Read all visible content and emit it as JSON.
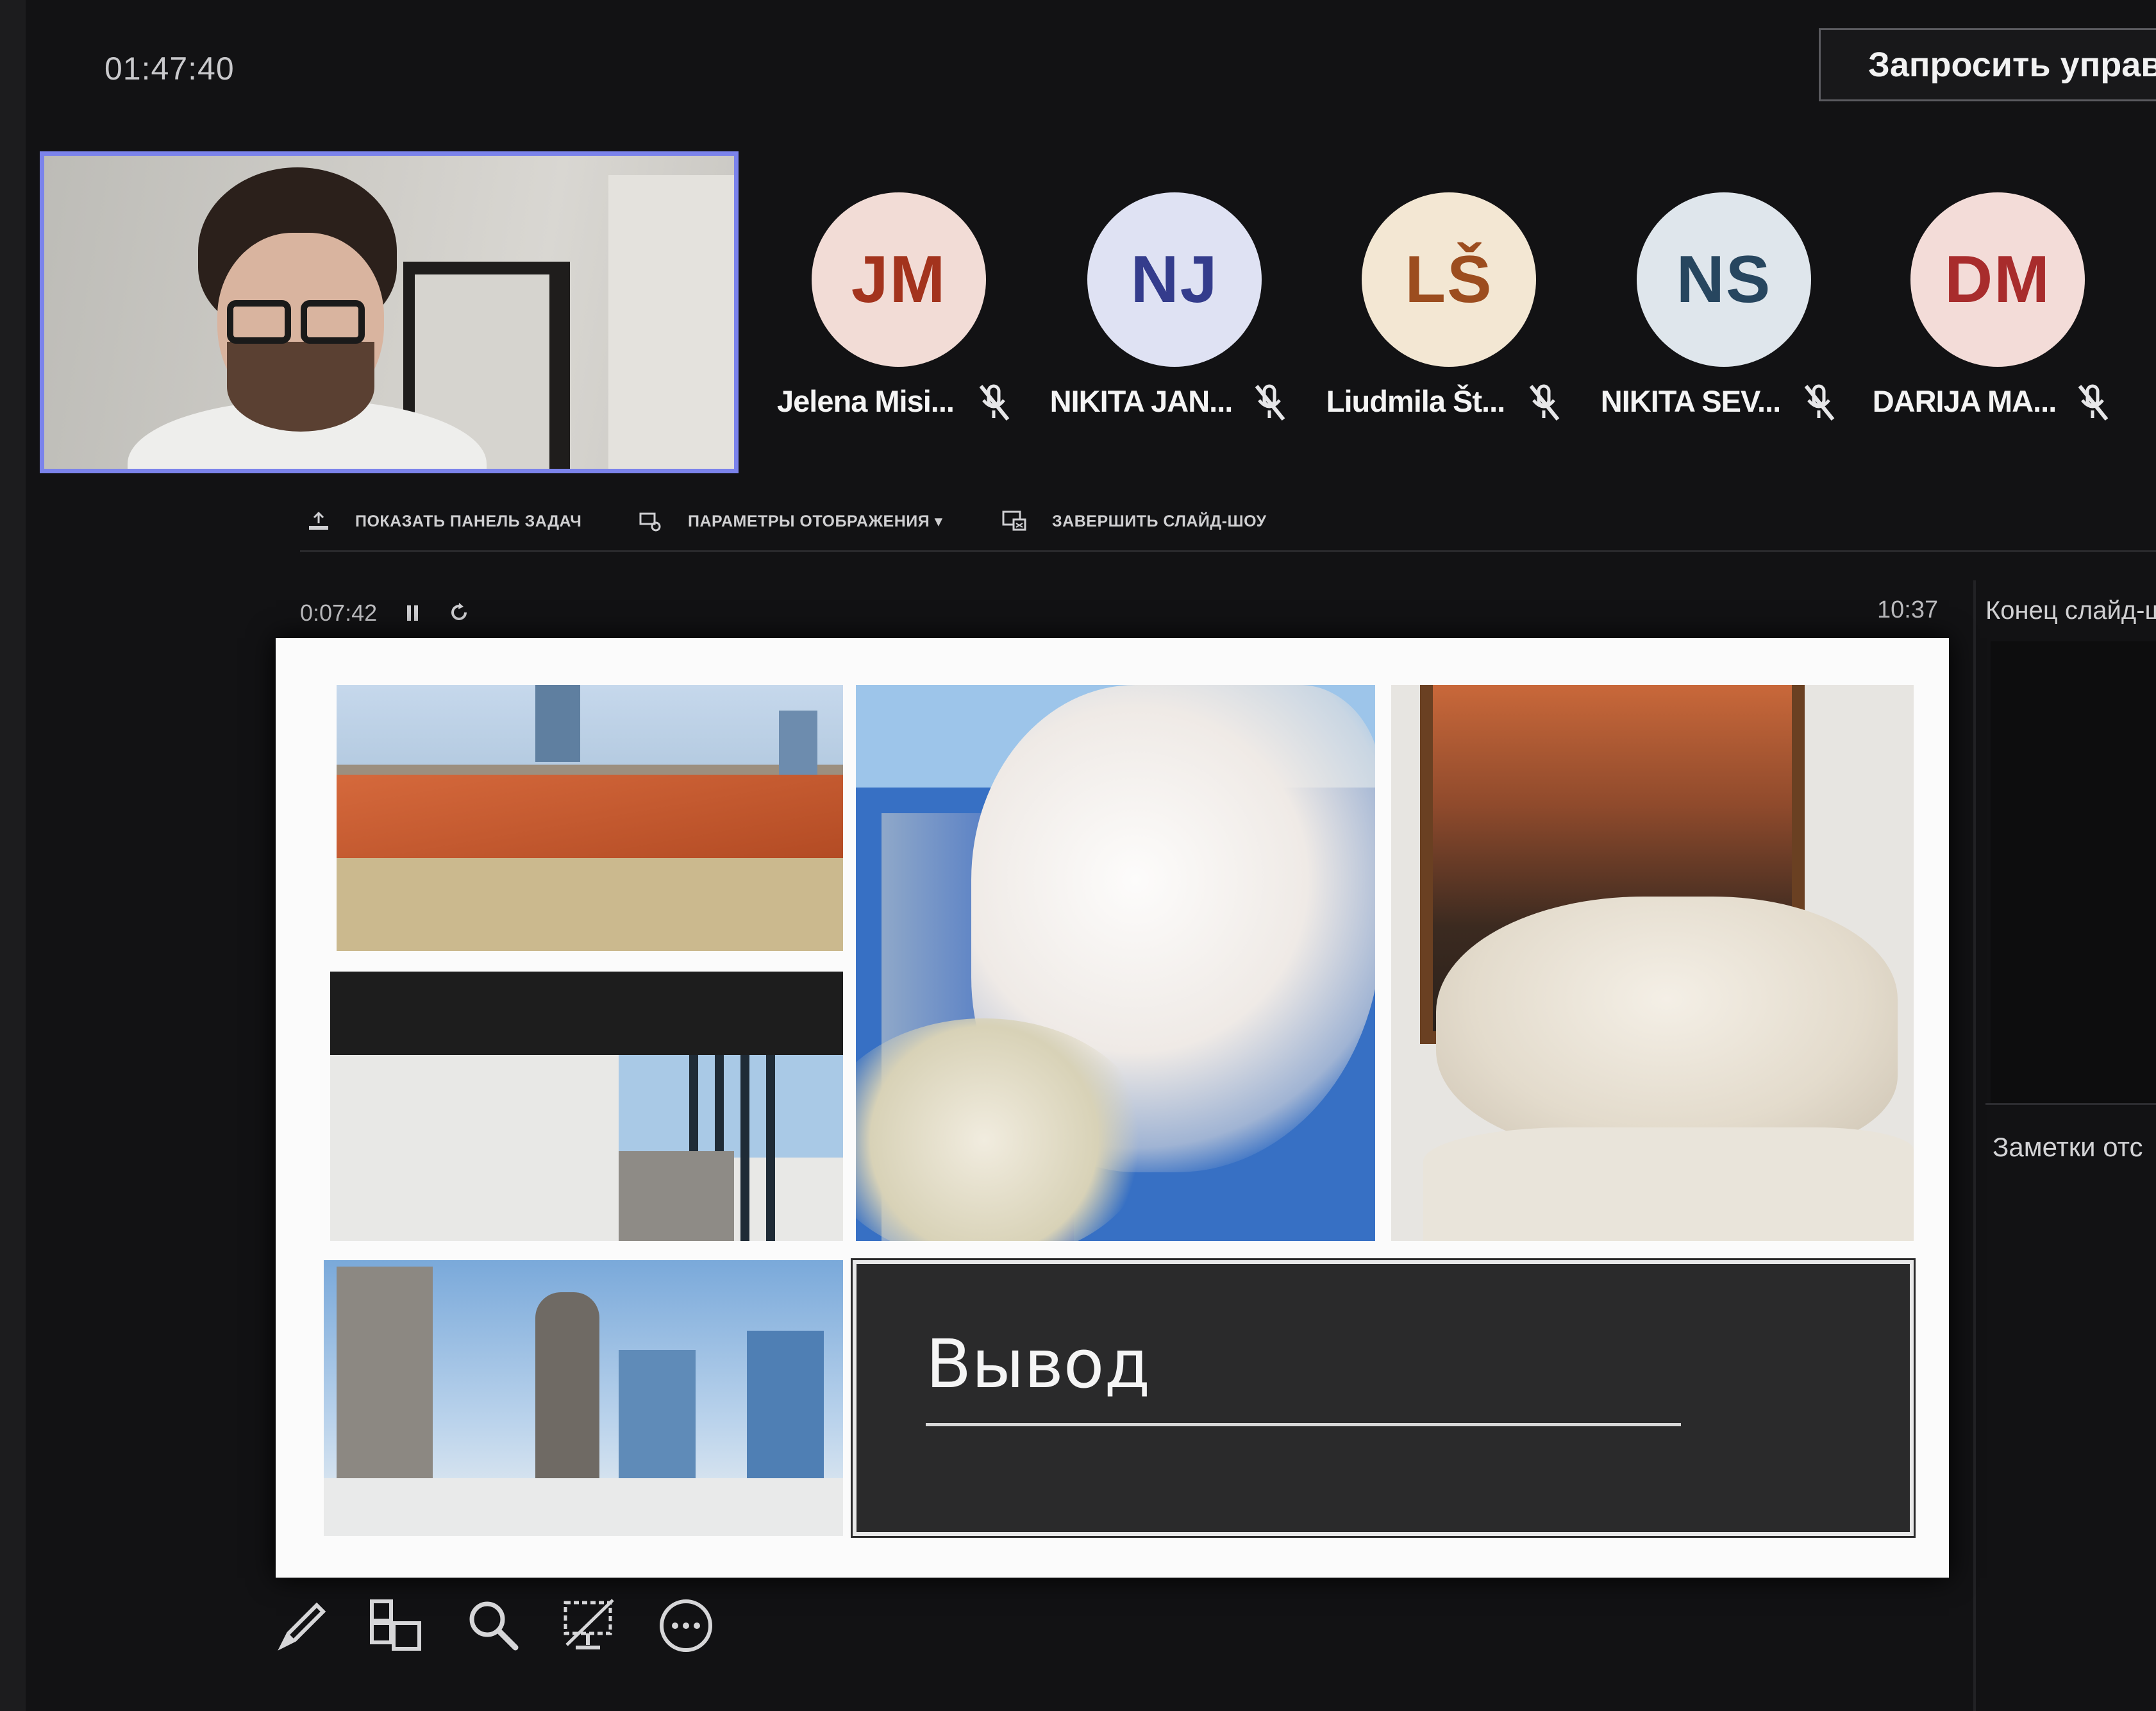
{
  "header": {
    "meeting_time": "01:47:40",
    "request_control_label": "Запросить управл"
  },
  "participants": [
    {
      "initials": "JM",
      "name": "Jelena Misi...",
      "bg": "#f2dcd6",
      "fg": "#a3331d",
      "muted": true
    },
    {
      "initials": "NJ",
      "name": "NIKITA JAN...",
      "bg": "#dfe2f3",
      "fg": "#343c8c",
      "muted": true
    },
    {
      "initials": "LŠ",
      "name": "Liudmila Št...",
      "bg": "#f3e7d3",
      "fg": "#9c4d1f",
      "muted": true
    },
    {
      "initials": "NS",
      "name": "NIKITA SEV...",
      "bg": "#dfe6ec",
      "fg": "#27465f",
      "muted": true
    },
    {
      "initials": "DM",
      "name": "DARIJA MA...",
      "bg": "#f3dcd8",
      "fg": "#a82c2c",
      "muted": true
    }
  ],
  "presenter_toolbar": {
    "show_taskbar": "ПОКАЗАТЬ ПАНЕЛЬ ЗАДАЧ",
    "display_settings": "ПАРАМЕТРЫ ОТОБРАЖЕНИЯ ▾",
    "end_slideshow": "ЗАВЕРШИТЬ СЛАЙД-ШОУ"
  },
  "slideshow": {
    "elapsed": "0:07:42",
    "clock": "10:37",
    "next_slide_label": "Конец слайд-ш",
    "notes_label": "Заметки отс"
  },
  "slide": {
    "title": "Вывод"
  },
  "bottom_tools": [
    "pen-icon",
    "all-slides-icon",
    "zoom-icon",
    "black-screen-icon",
    "more-options-icon"
  ],
  "colors": {
    "background": "#121214",
    "active_speaker_border": "#7b83eb",
    "slide_title_box": "#2a2a2b"
  }
}
